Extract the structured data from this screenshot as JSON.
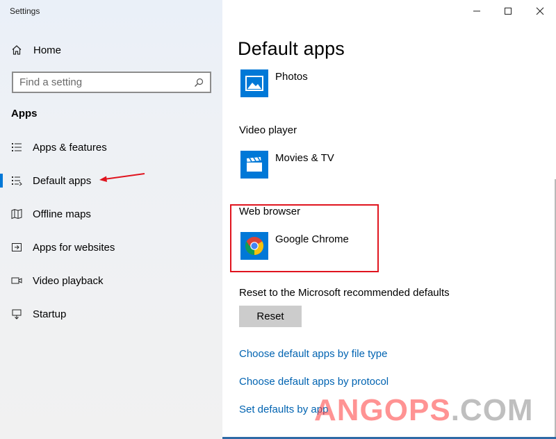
{
  "window": {
    "title": "Settings"
  },
  "sidebar": {
    "home_label": "Home",
    "search": {
      "placeholder": "Find a setting"
    },
    "section_title": "Apps",
    "items": [
      {
        "label": "Apps & features",
        "icon": "list-icon"
      },
      {
        "label": "Default apps",
        "icon": "default-apps-icon",
        "active": true
      },
      {
        "label": "Offline maps",
        "icon": "map-icon"
      },
      {
        "label": "Apps for websites",
        "icon": "website-apps-icon"
      },
      {
        "label": "Video playback",
        "icon": "video-icon"
      },
      {
        "label": "Startup",
        "icon": "startup-icon"
      }
    ]
  },
  "main": {
    "title": "Default apps",
    "photos_app": "Photos",
    "video_player_label": "Video player",
    "video_player_app": "Movies & TV",
    "web_browser_label": "Web browser",
    "web_browser_app": "Google Chrome",
    "reset_label": "Reset to the Microsoft recommended defaults",
    "reset_button": "Reset",
    "links": [
      "Choose default apps by file type",
      "Choose default apps by protocol",
      "Set defaults by app"
    ]
  },
  "watermark": {
    "part1": "ANGOPS",
    "part2": ".COM"
  },
  "colors": {
    "accent": "#0078d7",
    "link": "#0063b1",
    "highlight": "#e0141e"
  }
}
